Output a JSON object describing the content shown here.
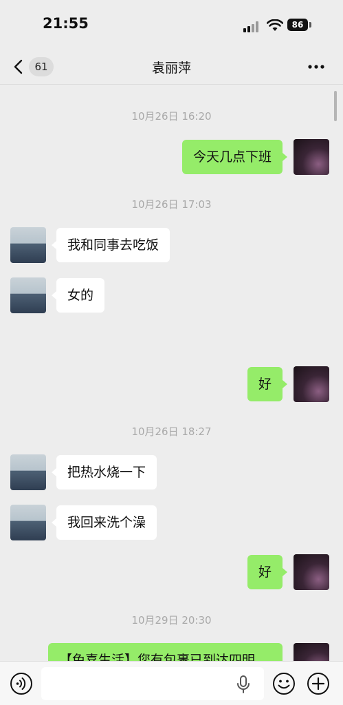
{
  "status_bar": {
    "time": "21:55",
    "battery": "86"
  },
  "nav": {
    "back_count": "61",
    "title": "袁丽萍"
  },
  "messages": [
    {
      "time": "10月26日 16:20"
    },
    {
      "from": "me",
      "text": "今天几点下班"
    },
    {
      "time": "10月26日 17:03"
    },
    {
      "from": "her",
      "text": "我和同事去吃饭"
    },
    {
      "from": "her",
      "text": "女的"
    },
    {
      "from": "me",
      "text": "好"
    },
    {
      "time": "10月26日 18:27"
    },
    {
      "from": "her",
      "text": "把热水烧一下"
    },
    {
      "from": "her",
      "text": "我回来洗个澡"
    },
    {
      "from": "me",
      "text": "好"
    },
    {
      "time": "10月29日 20:30"
    },
    {
      "from": "me",
      "text": "【兔喜生活】您有包裹已到达四明"
    }
  ],
  "input": {
    "placeholder": ""
  },
  "colors": {
    "bubble_out": "#95ec69",
    "bubble_in": "#ffffff",
    "background": "#ededed"
  }
}
